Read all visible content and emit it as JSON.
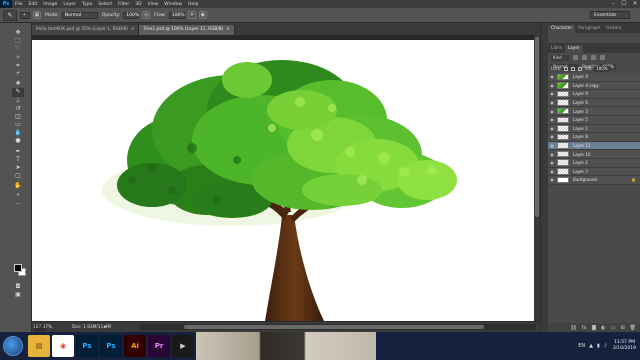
{
  "app": {
    "logo": "Ps"
  },
  "menubar": {
    "items": [
      "File",
      "Edit",
      "Image",
      "Layer",
      "Type",
      "Select",
      "Filter",
      "3D",
      "View",
      "Window",
      "Help"
    ],
    "window_controls": [
      "–",
      "☐",
      "✕"
    ]
  },
  "options": {
    "mode_label": "Mode:",
    "mode_value": "Normal",
    "opacity_label": "Opacity:",
    "opacity_value": "100%",
    "flow_label": "Flow:",
    "flow_value": "100%",
    "workspace": "Essentials"
  },
  "tabs": [
    {
      "label": "Perla tomKUK.psd @ 25% (Layer 1, RGB/8)",
      "close": "×",
      "active": false
    },
    {
      "label": "Tree1.psd @ 100% (Layer 11, RGB/8)",
      "close": "×",
      "active": true
    }
  ],
  "status": {
    "zoom": "107.37%",
    "doc": "Doc: 1.92M/11.4M",
    "arrow": "▸"
  },
  "panels": {
    "upper_tabs": [
      "Character",
      "Paragraph",
      "History"
    ],
    "layer_tabs": [
      "Libra",
      "Layer"
    ],
    "kind": "Kind",
    "blend_mode": "Normal",
    "opacity_label": "Opacity:",
    "opacity_value": "100%",
    "lock_label": "Lock:",
    "fill_label": "Fill:",
    "fill_value": "100%"
  },
  "layers": [
    {
      "name": "Layer 4",
      "thumb": "green",
      "italic": false,
      "selected": false,
      "locked": false
    },
    {
      "name": "Layer 4 copy",
      "thumb": "green",
      "italic": false,
      "selected": false,
      "locked": false
    },
    {
      "name": "Layer 9",
      "thumb": "trans",
      "italic": false,
      "selected": false,
      "locked": false
    },
    {
      "name": "Layer 6",
      "thumb": "trans",
      "italic": false,
      "selected": false,
      "locked": false
    },
    {
      "name": "Layer 3",
      "thumb": "green",
      "italic": false,
      "selected": false,
      "locked": false
    },
    {
      "name": "Layer 5",
      "thumb": "trans",
      "italic": false,
      "selected": false,
      "locked": false
    },
    {
      "name": "Layer 1",
      "thumb": "trans",
      "italic": false,
      "selected": false,
      "locked": false
    },
    {
      "name": "Layer 8",
      "thumb": "trans",
      "italic": false,
      "selected": false,
      "locked": false
    },
    {
      "name": "Layer 11",
      "thumb": "trans",
      "italic": false,
      "selected": true,
      "locked": false
    },
    {
      "name": "Layer 10",
      "thumb": "trans",
      "italic": false,
      "selected": false,
      "locked": false
    },
    {
      "name": "Layer 2",
      "thumb": "trans",
      "italic": false,
      "selected": false,
      "locked": false
    },
    {
      "name": "Layer 7",
      "thumb": "trans",
      "italic": false,
      "selected": false,
      "locked": false
    },
    {
      "name": "Background",
      "thumb": "white",
      "italic": true,
      "selected": false,
      "locked": true
    }
  ],
  "taskbar": {
    "apps": [
      {
        "name": "file-explorer",
        "glyph": "▤",
        "bg": "#e8b33b",
        "fg": "#5a3b00"
      },
      {
        "name": "chrome",
        "glyph": "◉",
        "bg": "#ffffff",
        "fg": "#db4437"
      },
      {
        "name": "photoshop",
        "glyph": "Ps",
        "bg": "#001e36",
        "fg": "#31a8ff"
      },
      {
        "name": "photoshop-2",
        "glyph": "Ps",
        "bg": "#001e36",
        "fg": "#31a8ff"
      },
      {
        "name": "illustrator",
        "glyph": "Ai",
        "bg": "#330000",
        "fg": "#ff9a00"
      },
      {
        "name": "premiere",
        "glyph": "Pr",
        "bg": "#2a0634",
        "fg": "#e58cff"
      },
      {
        "name": "media-app",
        "glyph": "▶",
        "bg": "#1a1a1a",
        "fg": "#d0d0d0"
      }
    ],
    "language": "EN",
    "time": "11:57 PM",
    "date": "3/10/2019"
  },
  "colors": {
    "foreground": "#000000",
    "background": "#ffffff"
  }
}
